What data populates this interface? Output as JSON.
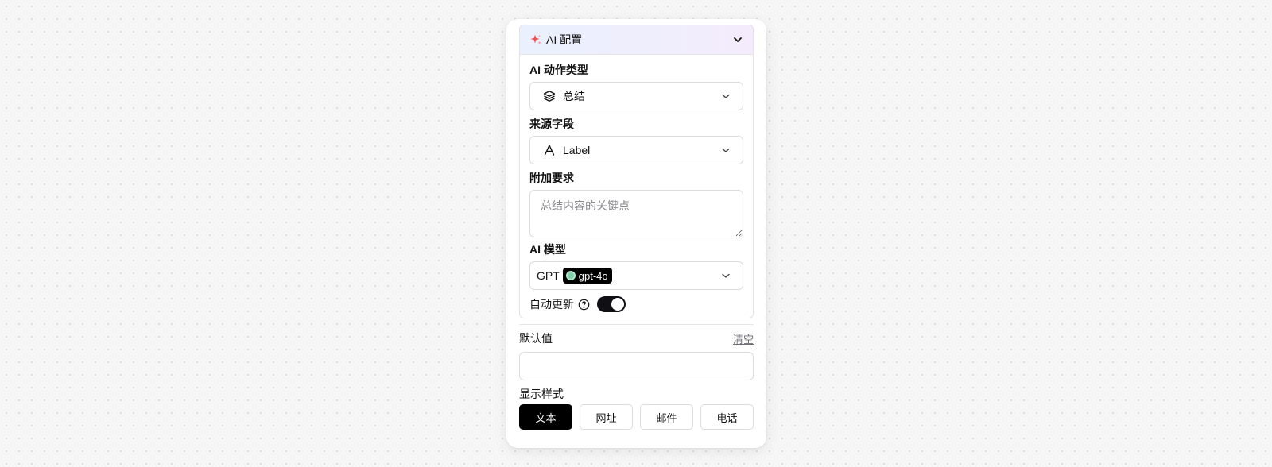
{
  "ai_config": {
    "header_title": "AI 配置",
    "action_type": {
      "label": "AI 动作类型",
      "value": "总结",
      "icon": "layers-icon"
    },
    "source_field": {
      "label": "来源字段",
      "value": "Label",
      "icon": "text-type-icon"
    },
    "extra_requirements": {
      "label": "附加要求",
      "value": "",
      "placeholder": "总结内容的关键点"
    },
    "model": {
      "label": "AI 模型",
      "provider": "GPT",
      "value": "gpt-4o"
    },
    "auto_update": {
      "label": "自动更新",
      "enabled": true
    }
  },
  "default_value": {
    "label": "默认值",
    "clear_label": "清空",
    "value": ""
  },
  "display_style": {
    "label": "显示样式",
    "options": [
      "文本",
      "网址",
      "邮件",
      "电话"
    ],
    "selected": "文本"
  },
  "colors": {
    "accent": "#000000",
    "sparkle_red": "#f05252",
    "sparkle_pink": "#f59aa0",
    "model_dot": "#7ed0a9"
  }
}
